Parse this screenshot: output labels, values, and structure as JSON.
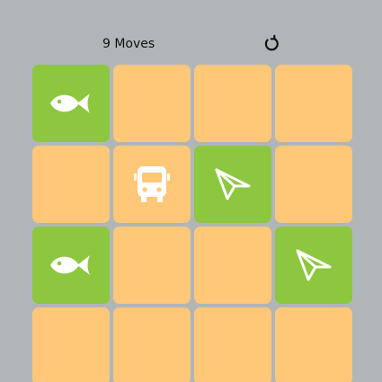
{
  "header": {
    "moves_label": "9 Moves",
    "restart_icon": "restart-icon"
  },
  "colors": {
    "background": "#b0b6b8",
    "hidden_tile": "#ffc778",
    "matched_tile": "#8dc63f",
    "icon": "#ffffff"
  },
  "board": {
    "rows": 4,
    "cols": 4,
    "tiles": [
      {
        "icon": "fish",
        "state": "matched"
      },
      {
        "icon": null,
        "state": "hidden"
      },
      {
        "icon": null,
        "state": "hidden"
      },
      {
        "icon": null,
        "state": "hidden"
      },
      {
        "icon": null,
        "state": "hidden"
      },
      {
        "icon": "bus",
        "state": "revealed"
      },
      {
        "icon": "paper-plane",
        "state": "matched"
      },
      {
        "icon": null,
        "state": "hidden"
      },
      {
        "icon": "fish",
        "state": "matched"
      },
      {
        "icon": null,
        "state": "hidden"
      },
      {
        "icon": null,
        "state": "hidden"
      },
      {
        "icon": "paper-plane",
        "state": "matched"
      },
      {
        "icon": null,
        "state": "hidden"
      },
      {
        "icon": null,
        "state": "hidden"
      },
      {
        "icon": null,
        "state": "hidden"
      },
      {
        "icon": null,
        "state": "hidden"
      }
    ]
  }
}
